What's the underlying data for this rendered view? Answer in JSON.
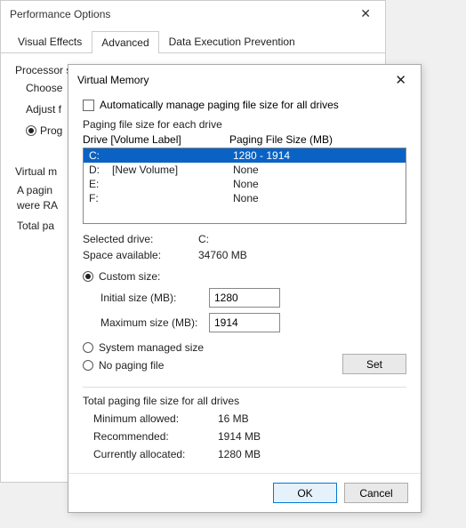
{
  "perf": {
    "title": "Performance Options",
    "tabs": {
      "visual": "Visual Effects",
      "advanced": "Advanced",
      "dep": "Data Execution Prevention"
    },
    "processor_label": "Processor scheduling",
    "choose": "Choose",
    "adjust": "Adjust f",
    "programs": "Prog",
    "vm_label": "Virtual m",
    "pg_line1": "A pagin",
    "pg_line2": "were RA",
    "total": "Total pa"
  },
  "vm": {
    "title": "Virtual Memory",
    "auto_label": "Automatically manage paging file size for all drives",
    "pfs_label": "Paging file size for each drive",
    "head_drive": "Drive  [Volume Label]",
    "head_size": "Paging File Size (MB)",
    "drives": [
      {
        "letter": "C:",
        "vol": "",
        "size": "1280 - 1914",
        "selected": true
      },
      {
        "letter": "D:",
        "vol": "[New Volume]",
        "size": "None",
        "selected": false
      },
      {
        "letter": "E:",
        "vol": "",
        "size": "None",
        "selected": false
      },
      {
        "letter": "F:",
        "vol": "",
        "size": "None",
        "selected": false
      }
    ],
    "selected_drive_label": "Selected drive:",
    "selected_drive_value": "C:",
    "space_label": "Space available:",
    "space_value": "34760 MB",
    "custom_label": "Custom size:",
    "initial_label": "Initial size (MB):",
    "initial_value": "1280",
    "max_label": "Maximum size (MB):",
    "max_value": "1914",
    "system_label": "System managed size",
    "none_label": "No paging file",
    "set_btn": "Set",
    "totals_label": "Total paging file size for all drives",
    "min_label": "Minimum allowed:",
    "min_value": "16 MB",
    "rec_label": "Recommended:",
    "rec_value": "1914 MB",
    "cur_label": "Currently allocated:",
    "cur_value": "1280 MB",
    "ok": "OK",
    "cancel": "Cancel"
  }
}
